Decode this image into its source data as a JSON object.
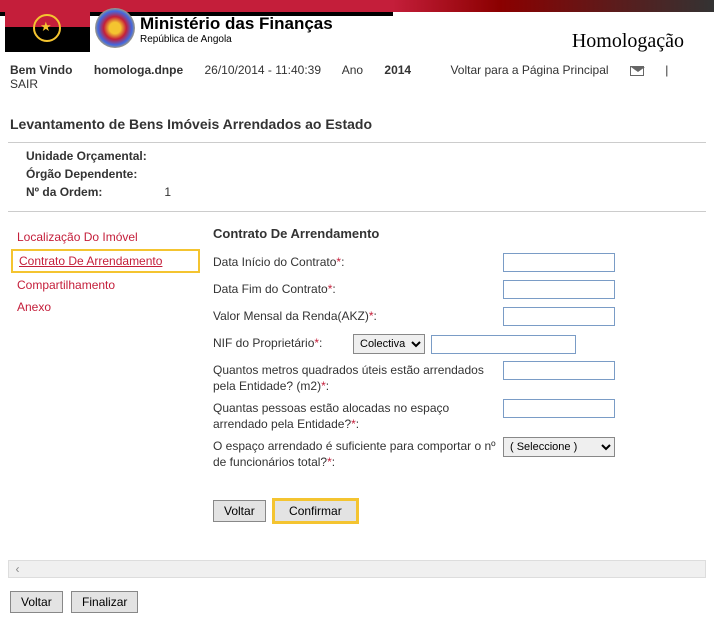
{
  "header": {
    "ministry_title": "Ministério das Finanças",
    "ministry_subtitle": "República de Angola",
    "env_label": "Homologação"
  },
  "navbar": {
    "welcome": "Bem Vindo",
    "user": "homologa.dnpe",
    "datetime": "26/10/2014 - 11:40:39",
    "year_label": "Ano",
    "year": "2014",
    "back_link": "Voltar para a Página Principal",
    "logout": "| SAIR"
  },
  "page_title": "Levantamento de Bens Imóveis Arrendados ao Estado",
  "info": {
    "unidade_label": "Unidade Orçamental:",
    "unidade_value": "",
    "orgao_label": "Órgão Dependente:",
    "orgao_value": "",
    "ordem_label": "Nº da Ordem:",
    "ordem_value": "1"
  },
  "sidebar": {
    "items": [
      {
        "label": "Localização Do Imóvel"
      },
      {
        "label": "Contrato De Arrendamento"
      },
      {
        "label": "Compartilhamento"
      },
      {
        "label": "Anexo"
      }
    ]
  },
  "form": {
    "title": "Contrato De Arrendamento",
    "data_inicio_label": "Data Início do Contrato",
    "data_fim_label": "Data Fim do Contrato",
    "valor_mensal_label": "Valor Mensal da Renda(AKZ)",
    "nif_label": "NIF do Proprietário",
    "nif_select_value": "Colectiva",
    "metros_label": "Quantos metros quadrados úteis estão arrendados pela Entidade? (m2)",
    "pessoas_label": "Quantas pessoas estão alocadas no espaço arrendado pela Entidade?",
    "espaco_label": "O espaço arrendado é suficiente para comportar o nº de funcionários total?",
    "espaco_select_value": "( Seleccione )",
    "voltar": "Voltar",
    "confirmar": "Confirmar"
  },
  "bottom": {
    "voltar": "Voltar",
    "finalizar": "Finalizar"
  }
}
